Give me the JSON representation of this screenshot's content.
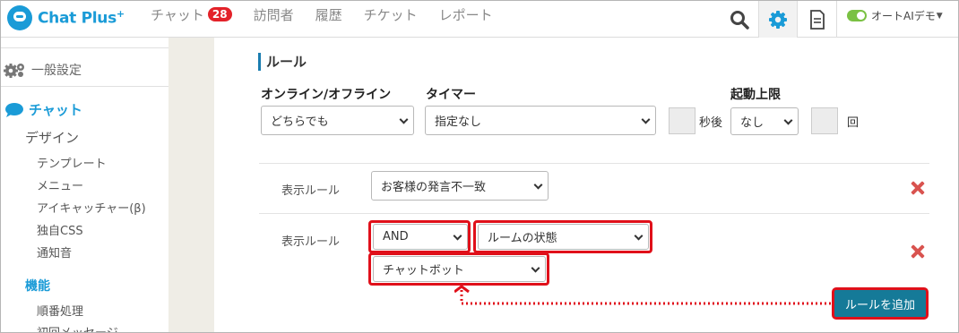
{
  "app": {
    "logo_text": "Chat Plus",
    "logo_sup": "+"
  },
  "nav": {
    "items": [
      {
        "label": "チャット",
        "badge": "28"
      },
      {
        "label": "訪問者"
      },
      {
        "label": "履歴"
      },
      {
        "label": "チケット"
      },
      {
        "label": "レポート"
      }
    ]
  },
  "header": {
    "icons": [
      "search-icon",
      "gear-icon",
      "document-icon"
    ],
    "user_label": "オートAIデモ",
    "user_status_color": "#7ac143"
  },
  "sidebar": {
    "general_label": "一般設定",
    "chat_label": "チャット",
    "design_label": "デザイン",
    "design_items": [
      "テンプレート",
      "メニュー",
      "アイキャッチャー(β)",
      "独自CSS",
      "通知音"
    ],
    "function_label": "機能",
    "function_items": [
      "順番処理",
      "初回メッセージ"
    ]
  },
  "rule_section": {
    "title": "ルール",
    "online_label": "オンライン/オフライン",
    "online_value": "どちらでも",
    "timer_label": "タイマー",
    "timer_value": "指定なし",
    "seconds_after": "秒後",
    "limit_label": "起動上限",
    "limit_value": "なし",
    "times_label": "回"
  },
  "rules": {
    "row1": {
      "label": "表示ルール",
      "condition": "お客様の発言不一致"
    },
    "row2": {
      "label": "表示ルール",
      "operator": "AND",
      "target": "ルームの状態",
      "state": "チャットボット"
    },
    "add_button": "ルールを追加"
  },
  "colors": {
    "accent": "#1a9bd7",
    "highlight": "#e0101a",
    "add_button": "#157a98",
    "delete": "#d9534f",
    "badge": "#e32229"
  }
}
